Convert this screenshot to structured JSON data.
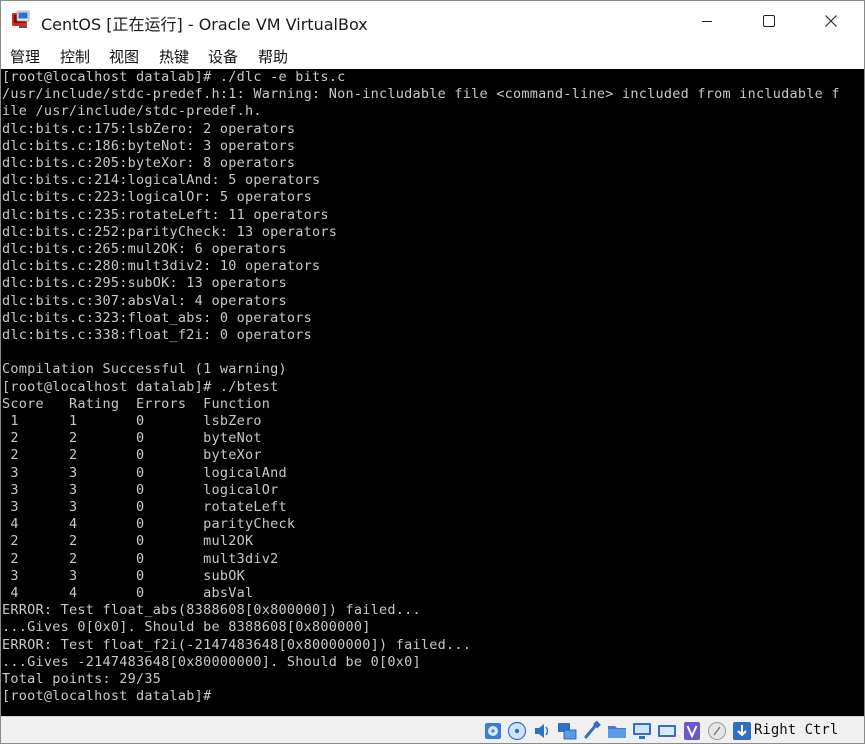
{
  "window": {
    "title": "CentOS [正在运行] - Oracle VM VirtualBox",
    "app_icon": "virtualbox-icon",
    "controls": [
      "minimize-icon",
      "maximize-icon",
      "close-icon"
    ]
  },
  "menubar": {
    "items": [
      "管理",
      "控制",
      "视图",
      "热键",
      "设备",
      "帮助"
    ]
  },
  "terminal": {
    "lines": [
      "[root@localhost datalab]# ./dlc -e bits.c",
      "/usr/include/stdc-predef.h:1: Warning: Non-includable file <command-line> included from includable f",
      "ile /usr/include/stdc-predef.h.",
      "dlc:bits.c:175:lsbZero: 2 operators",
      "dlc:bits.c:186:byteNot: 3 operators",
      "dlc:bits.c:205:byteXor: 8 operators",
      "dlc:bits.c:214:logicalAnd: 5 operators",
      "dlc:bits.c:223:logicalOr: 5 operators",
      "dlc:bits.c:235:rotateLeft: 11 operators",
      "dlc:bits.c:252:parityCheck: 13 operators",
      "dlc:bits.c:265:mul2OK: 6 operators",
      "dlc:bits.c:280:mult3div2: 10 operators",
      "dlc:bits.c:295:subOK: 13 operators",
      "dlc:bits.c:307:absVal: 4 operators",
      "dlc:bits.c:323:float_abs: 0 operators",
      "dlc:bits.c:338:float_f2i: 0 operators",
      "",
      "Compilation Successful (1 warning)",
      "[root@localhost datalab]# ./btest",
      "Score   Rating  Errors  Function",
      " 1      1       0       lsbZero",
      " 2      2       0       byteNot",
      " 2      2       0       byteXor",
      " 3      3       0       logicalAnd",
      " 3      3       0       logicalOr",
      " 3      3       0       rotateLeft",
      " 4      4       0       parityCheck",
      " 2      2       0       mul2OK",
      " 2      2       0       mult3div2",
      " 3      3       0       subOK",
      " 4      4       0       absVal",
      "ERROR: Test float_abs(8388608[0x800000]) failed...",
      "...Gives 0[0x0]. Should be 8388608[0x800000]",
      "ERROR: Test float_f2i(-2147483648[0x80000000]) failed...",
      "...Gives -2147483648[0x80000000]. Should be 0[0x0]",
      "Total points: 29/35",
      "[root@localhost datalab]# "
    ]
  },
  "statusbar": {
    "icons": [
      "hard-disk-icon",
      "optical-drive-icon",
      "audio-icon",
      "network-icon",
      "usb-icon",
      "shared-folders-icon",
      "display-icon",
      "video-capture-icon",
      "mouse-integration-icon",
      "keyboard-capture-icon"
    ],
    "host_key": "Right Ctrl"
  }
}
